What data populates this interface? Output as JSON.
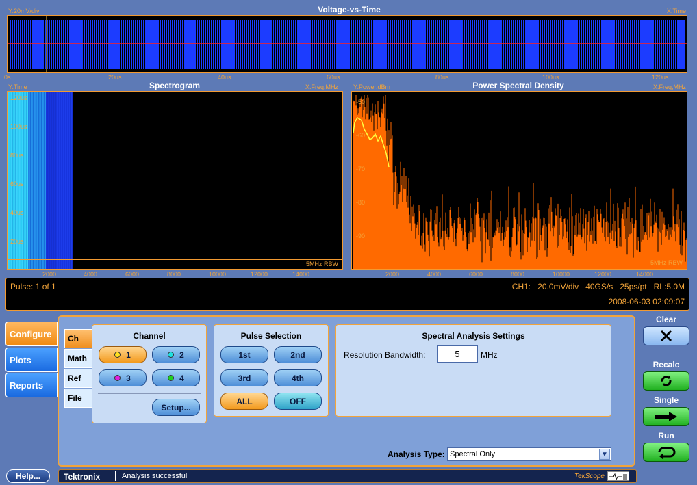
{
  "vt": {
    "title": "Voltage-vs-Time",
    "ylabel": "Y:20mV/div",
    "xlabel": "X:Time",
    "ticks": [
      "0s",
      "20us",
      "40us",
      "60us",
      "80us",
      "100us",
      "120us"
    ]
  },
  "spectrogram": {
    "title": "Spectrogram",
    "ylabel": "Y:Time",
    "xlabel": "X:Freq,MHz",
    "yticks": [
      "120us",
      "100us",
      "80us",
      "60us",
      "40us",
      "20us"
    ],
    "xticks": [
      "2000",
      "4000",
      "6000",
      "8000",
      "10000",
      "12000",
      "14000"
    ],
    "rbw": "5MHz RBW"
  },
  "psd": {
    "title": "Power Spectral Density",
    "ylabel": "Y:Power,dBm",
    "xlabel": "X:Freq,MHz",
    "yticks": [
      "-50",
      "-60",
      "-70",
      "-80",
      "-90"
    ],
    "xticks": [
      "2000",
      "4000",
      "6000",
      "8000",
      "10000",
      "12000",
      "14000"
    ],
    "rbw": "5MHz RBW"
  },
  "status": {
    "pulse": "Pulse: 1 of 1",
    "ch1": "CH1:",
    "vdiv": "20.0mV/div",
    "rate": "40GS/s",
    "res": "25ps/pt",
    "rl": "RL:5.0M",
    "datetime": "2008-06-03 02:09:07"
  },
  "sidetabs": [
    "Configure",
    "Plots",
    "Reports"
  ],
  "subtabs": [
    "Ch",
    "Math",
    "Ref",
    "File"
  ],
  "channel": {
    "title": "Channel",
    "buttons": [
      "1",
      "2",
      "3",
      "4"
    ],
    "setup": "Setup..."
  },
  "pulse_selection": {
    "title": "Pulse Selection",
    "buttons": [
      "1st",
      "2nd",
      "3rd",
      "4th",
      "ALL",
      "OFF"
    ]
  },
  "spectral": {
    "title": "Spectral Analysis Settings",
    "rbw_label": "Resolution Bandwidth:",
    "rbw_value": "5",
    "rbw_unit": "MHz"
  },
  "analysis_type": {
    "label": "Analysis Type:",
    "value": "Spectral Only"
  },
  "right": {
    "clear": "Clear",
    "recalc": "Recalc",
    "single": "Single",
    "run": "Run"
  },
  "footer": {
    "help": "Help...",
    "brand": "Tektronix",
    "message": "Analysis successful",
    "tekscope": "TekScope"
  },
  "colors": {
    "accent": "#f29a32",
    "trace_blue": "#1c3cff",
    "psd_orange": "#ff6a00",
    "psd_yellow": "#ffff40",
    "background": "#5d7ab6"
  }
}
